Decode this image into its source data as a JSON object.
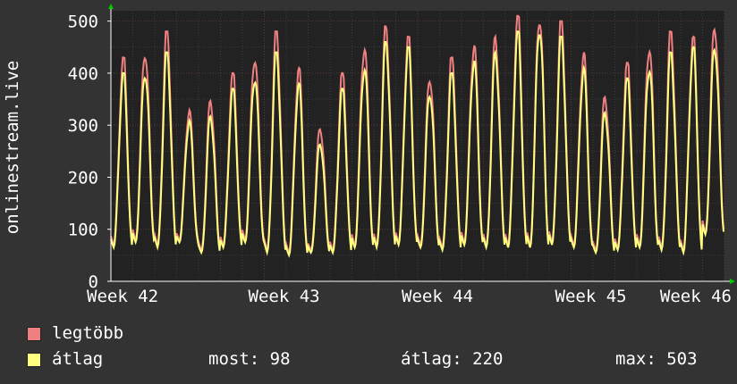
{
  "chart_data": {
    "type": "line",
    "ylabel": "onlinestream.live",
    "ylim": [
      0,
      520
    ],
    "yticks": [
      0,
      100,
      200,
      300,
      400,
      500
    ],
    "xticks": [
      "Week 42",
      "Week 43",
      "Week 44",
      "Week 45",
      "Week 46"
    ],
    "grid": true,
    "colors": {
      "background": "#333333",
      "plot": "#222222",
      "grid": "#444444",
      "max": "#f08080",
      "avg": "#ffff80"
    },
    "series": [
      {
        "name": "legtöbb",
        "color": "#f08080",
        "daily_peaks": [
          430,
          450,
          480,
          330,
          350,
          400,
          440,
          480,
          410,
          300,
          400,
          460,
          490,
          470,
          400,
          430,
          460,
          470,
          510,
          520,
          500,
          440,
          360,
          420,
          460,
          480,
          470,
          500
        ],
        "daily_mins": [
          70,
          80,
          70,
          80,
          60,
          70,
          80,
          60,
          55,
          60,
          60,
          70,
          70,
          75,
          70,
          65,
          75,
          70,
          70,
          70,
          75,
          70,
          60,
          65,
          70,
          65,
          60,
          95
        ]
      },
      {
        "name": "átlag",
        "color": "#ffff80",
        "daily_peaks": [
          400,
          410,
          440,
          310,
          320,
          370,
          400,
          440,
          380,
          270,
          370,
          420,
          460,
          450,
          370,
          400,
          430,
          440,
          480,
          500,
          470,
          410,
          330,
          390,
          420,
          440,
          450,
          460
        ],
        "daily_mins": [
          65,
          75,
          65,
          75,
          55,
          65,
          75,
          55,
          50,
          55,
          55,
          65,
          65,
          70,
          65,
          60,
          70,
          65,
          65,
          65,
          70,
          65,
          55,
          60,
          65,
          60,
          55,
          90
        ]
      }
    ]
  },
  "legend": {
    "items": [
      {
        "name": "legtöbb",
        "color": "#f08080"
      },
      {
        "name": "átlag",
        "color": "#ffff80"
      }
    ],
    "most": "most: 98",
    "atlag": "átlag: 220",
    "max": "max: 503"
  }
}
